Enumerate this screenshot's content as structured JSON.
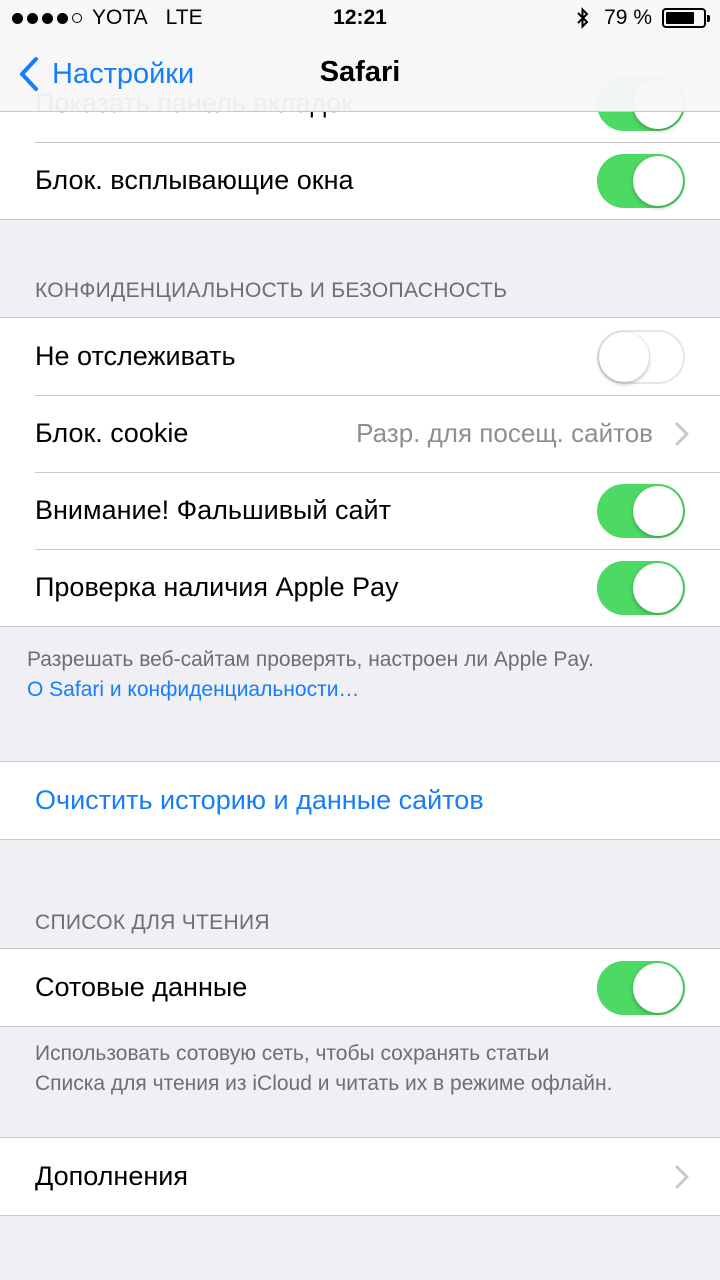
{
  "status_bar": {
    "carrier": "YOTA",
    "network": "LTE",
    "time": "12:21",
    "battery_text": "79 %",
    "battery_level": 0.79
  },
  "nav": {
    "back_label": "Настройки",
    "title": "Safari"
  },
  "top_group": {
    "partial_label": "Показать панель вкладок",
    "partial_toggle_on": true,
    "popup_label": "Блок. всплывающие окна",
    "popup_toggle_on": true
  },
  "privacy": {
    "header": "КОНФИДЕНЦИАЛЬНОСТЬ И БЕЗОПАСНОСТЬ",
    "do_not_track_label": "Не отслеживать",
    "do_not_track_on": false,
    "cookie_label": "Блок. cookie",
    "cookie_value": "Разр. для посещ. сайтов",
    "fraud_label": "Внимание! Фальшивый сайт",
    "fraud_on": true,
    "applepay_label": "Проверка наличия Apple Pay",
    "applepay_on": true,
    "footer_text": "Разрешать веб-сайтам проверять, настроен ли Apple Pay.",
    "footer_link": "О Safari и конфиденциальности…"
  },
  "clear": {
    "label": "Очистить историю и данные сайтов"
  },
  "reading_list": {
    "header": "СПИСОК ДЛЯ ЧТЕНИЯ",
    "cellular_label": "Сотовые данные",
    "cellular_on": true,
    "footer_line1": "Использовать сотовую сеть, чтобы сохранять статьи",
    "footer_line2": "Списка для чтения из iCloud и читать их в режиме офлайн."
  },
  "advanced": {
    "label": "Дополнения"
  },
  "colors": {
    "accent": "#157efb",
    "toggle_on": "#4cd964",
    "background": "#efeff4"
  }
}
